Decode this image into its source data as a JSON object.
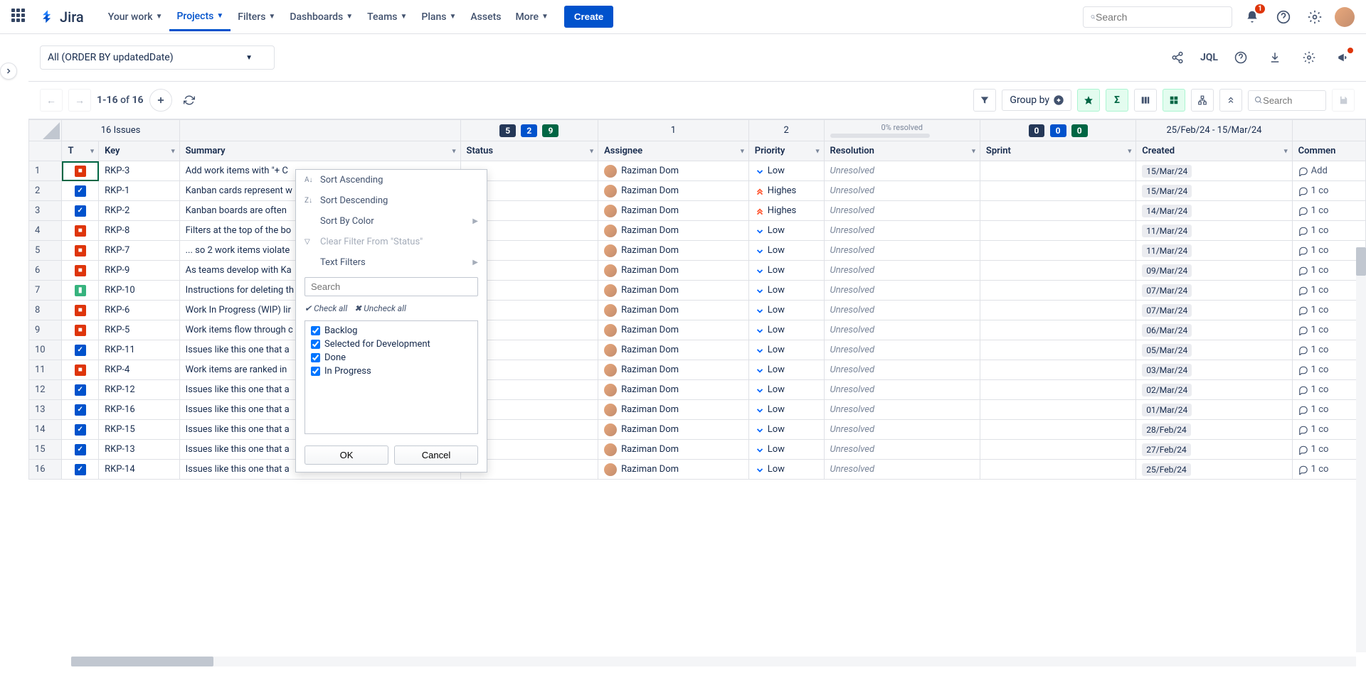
{
  "topnav": {
    "brand": "Jira",
    "items": [
      "Your work",
      "Projects",
      "Filters",
      "Dashboards",
      "Teams",
      "Plans",
      "Assets",
      "More"
    ],
    "active_index": 1,
    "create": "Create",
    "search_placeholder": "Search",
    "notif_count": "1"
  },
  "filterbar": {
    "selected_filter": "All (ORDER BY updatedDate)",
    "jql": "JQL"
  },
  "toolbar": {
    "range": "1-16",
    "of": "of",
    "total": "16",
    "groupby": "Group by",
    "search_placeholder": "Search"
  },
  "summary_row": {
    "issues_label": "16 Issues",
    "status_counts": [
      "5",
      "2",
      "9"
    ],
    "assignee_count": "1",
    "priority_count": "2",
    "resolution_text": "0% resolved",
    "sprint_counts": [
      "0",
      "0",
      "0"
    ],
    "created_range": "25/Feb/24 - 15/Mar/24"
  },
  "columns": {
    "type": "T",
    "key": "Key",
    "summary": "Summary",
    "status": "Status",
    "assignee": "Assignee",
    "priority": "Priority",
    "resolution": "Resolution",
    "sprint": "Sprint",
    "created": "Created",
    "comment": "Commen"
  },
  "rows": [
    {
      "n": "1",
      "type": "bug",
      "key": "RKP-3",
      "summary": "Add work items with \"+ C",
      "assignee": "Raziman Dom",
      "priority": "Low",
      "resolution": "Unresolved",
      "created": "15/Mar/24",
      "comment": "Add"
    },
    {
      "n": "2",
      "type": "task",
      "key": "RKP-1",
      "summary": "Kanban cards represent w",
      "assignee": "Raziman Dom",
      "priority": "Highes",
      "resolution": "Unresolved",
      "created": "15/Mar/24",
      "comment": "1 co"
    },
    {
      "n": "3",
      "type": "task",
      "key": "RKP-2",
      "summary": "Kanban boards are often",
      "assignee": "Raziman Dom",
      "priority": "Highes",
      "resolution": "Unresolved",
      "created": "14/Mar/24",
      "comment": "1 co"
    },
    {
      "n": "4",
      "type": "bug",
      "key": "RKP-8",
      "summary": "Filters at the top of the bo",
      "assignee": "Raziman Dom",
      "priority": "Low",
      "resolution": "Unresolved",
      "created": "11/Mar/24",
      "comment": "1 co"
    },
    {
      "n": "5",
      "type": "bug",
      "key": "RKP-7",
      "summary": "... so 2 work items violate",
      "assignee": "Raziman Dom",
      "priority": "Low",
      "resolution": "Unresolved",
      "created": "11/Mar/24",
      "comment": "1 co"
    },
    {
      "n": "6",
      "type": "bug",
      "key": "RKP-9",
      "summary": "As teams develop with Ka",
      "assignee": "Raziman Dom",
      "priority": "Low",
      "resolution": "Unresolved",
      "created": "09/Mar/24",
      "comment": "1 co"
    },
    {
      "n": "7",
      "type": "story",
      "key": "RKP-10",
      "summary": "Instructions for deleting th",
      "assignee": "Raziman Dom",
      "priority": "Low",
      "resolution": "Unresolved",
      "created": "07/Mar/24",
      "comment": "1 co"
    },
    {
      "n": "8",
      "type": "bug",
      "key": "RKP-6",
      "summary": "Work In Progress (WIP) lir",
      "assignee": "Raziman Dom",
      "priority": "Low",
      "resolution": "Unresolved",
      "created": "07/Mar/24",
      "comment": "1 co"
    },
    {
      "n": "9",
      "type": "bug",
      "key": "RKP-5",
      "summary": "Work items flow through c",
      "assignee": "Raziman Dom",
      "priority": "Low",
      "resolution": "Unresolved",
      "created": "06/Mar/24",
      "comment": "1 co"
    },
    {
      "n": "10",
      "type": "task",
      "key": "RKP-11",
      "summary": "Issues like this one that a",
      "assignee": "Raziman Dom",
      "priority": "Low",
      "resolution": "Unresolved",
      "created": "05/Mar/24",
      "comment": "1 co"
    },
    {
      "n": "11",
      "type": "bug",
      "key": "RKP-4",
      "summary": "Work items are ranked in",
      "assignee": "Raziman Dom",
      "priority": "Low",
      "resolution": "Unresolved",
      "created": "03/Mar/24",
      "comment": "1 co"
    },
    {
      "n": "12",
      "type": "task",
      "key": "RKP-12",
      "summary": "Issues like this one that a",
      "assignee": "Raziman Dom",
      "priority": "Low",
      "resolution": "Unresolved",
      "created": "02/Mar/24",
      "comment": "1 co"
    },
    {
      "n": "13",
      "type": "task",
      "key": "RKP-16",
      "summary": "Issues like this one that a",
      "assignee": "Raziman Dom",
      "priority": "Low",
      "resolution": "Unresolved",
      "created": "01/Mar/24",
      "comment": "1 co"
    },
    {
      "n": "14",
      "type": "task",
      "key": "RKP-15",
      "summary": "Issues like this one that a",
      "assignee": "Raziman Dom",
      "priority": "Low",
      "resolution": "Unresolved",
      "created": "28/Feb/24",
      "comment": "1 co"
    },
    {
      "n": "15",
      "type": "task",
      "key": "RKP-13",
      "summary": "Issues like this one that a",
      "assignee": "Raziman Dom",
      "priority": "Low",
      "resolution": "Unresolved",
      "created": "27/Feb/24",
      "comment": "1 co"
    },
    {
      "n": "16",
      "type": "task",
      "key": "RKP-14",
      "summary": "Issues like this one that a",
      "assignee": "Raziman Dom",
      "priority": "Low",
      "resolution": "Unresolved",
      "created": "25/Feb/24",
      "comment": "1 co"
    }
  ],
  "filter_menu": {
    "sort_asc": "Sort Ascending",
    "sort_desc": "Sort Descending",
    "sort_color": "Sort By Color",
    "clear": "Clear Filter From \"Status\"",
    "text_filters": "Text Filters",
    "search_placeholder": "Search",
    "check_all": "Check all",
    "uncheck_all": "Uncheck all",
    "options": [
      "Backlog",
      "Selected for Development",
      "Done",
      "In Progress"
    ],
    "ok": "OK",
    "cancel": "Cancel"
  }
}
